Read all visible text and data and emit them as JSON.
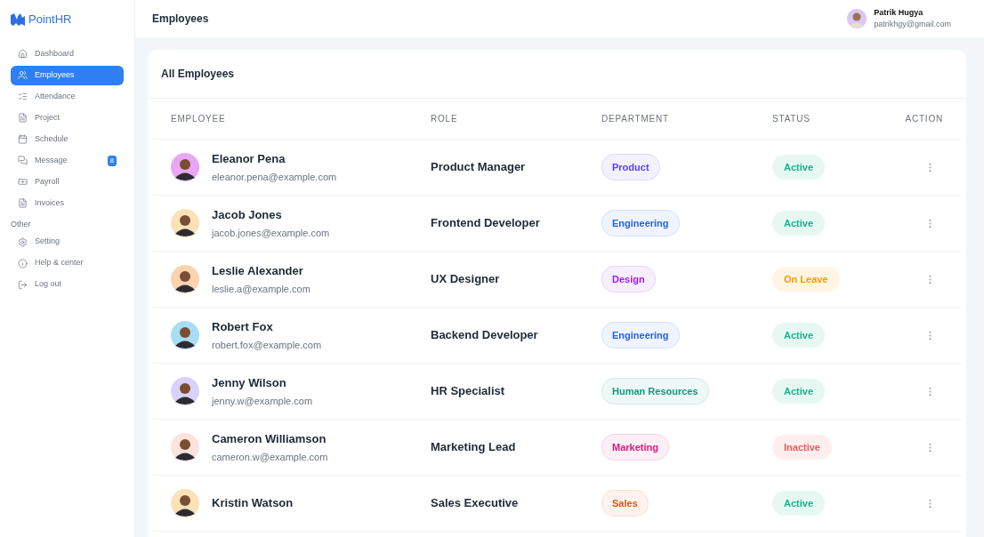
{
  "brand": "PointHR",
  "sidebar": {
    "items": [
      {
        "label": "Dashboard",
        "selected": false
      },
      {
        "label": "Employees",
        "selected": true
      },
      {
        "label": "Attendance",
        "selected": false
      },
      {
        "label": "Project",
        "selected": false
      },
      {
        "label": "Schedule",
        "selected": false
      },
      {
        "label": "Message",
        "selected": false,
        "badge": "8"
      },
      {
        "label": "Payroll",
        "selected": false
      },
      {
        "label": "Invoices",
        "selected": false
      }
    ],
    "section": "Other",
    "other_items": [
      {
        "label": "Setting",
        "selected": false
      },
      {
        "label": "Help & center",
        "selected": false
      },
      {
        "label": "Log out",
        "selected": false
      }
    ]
  },
  "header": {
    "title": "Employees",
    "user": {
      "name": "Patrik Hugya",
      "email": "patrikhgy@gmail.com"
    }
  },
  "card": {
    "title": "All Employees"
  },
  "table": {
    "columns": [
      "EMPLOYEE",
      "ROLE",
      "DEPARTMENT",
      "STATUS",
      "ACTION"
    ],
    "rows": [
      {
        "name": "Eleanor Pena",
        "email": "eleanor.pena@example.com",
        "role": "Product Manager",
        "department": "Product",
        "color": "#5b3df5",
        "status": {
          "text": "Active",
          "color": "#12b886"
        }
      },
      {
        "name": "Jacob Jones",
        "email": "jacob.jones@example.com",
        "role": "Frontend Developer",
        "department": "Engineering",
        "color": "#2563eb",
        "status": {
          "text": "Active",
          "color": "#12b886"
        }
      },
      {
        "name": "Leslie Alexander",
        "email": "leslie.a@example.com",
        "role": "UX Designer",
        "department": "Design",
        "color": "#a21cf0",
        "status": {
          "text": "On Leave",
          "color": "#f59f00"
        }
      },
      {
        "name": "Robert Fox",
        "email": "robert.fox@example.com",
        "role": "Backend Developer",
        "department": "Engineering",
        "color": "#2563eb",
        "status": {
          "text": "Active",
          "color": "#12b886"
        }
      },
      {
        "name": "Jenny Wilson",
        "email": "jenny.w@example.com",
        "role": "HR Specialist",
        "department": "Human Resources",
        "color": "#0f9a7e",
        "status": {
          "text": "Active",
          "color": "#12b886"
        }
      },
      {
        "name": "Cameron Williamson",
        "email": "cameron.w@example.com",
        "role": "Marketing Lead",
        "department": "Marketing",
        "color": "#e0177a",
        "status": {
          "text": "Inactive",
          "color": "#f25a5a"
        }
      },
      {
        "name": "Kristin Watson",
        "role": "Sales Executive",
        "department": "Sales",
        "color": "#ea580c",
        "status": {
          "text": "Active",
          "color": "#12b886"
        }
      }
    ]
  }
}
